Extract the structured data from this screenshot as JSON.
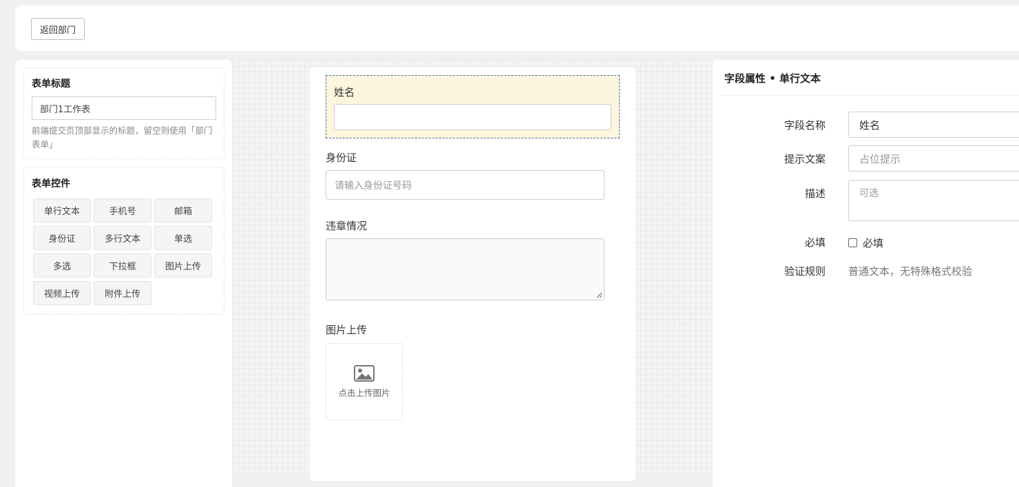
{
  "topbar": {
    "back_label": "返回部门"
  },
  "left": {
    "title_section": {
      "heading": "表单标题",
      "input_value": "部门1工作表",
      "hint": "前端提交页顶部显示的标题，留空则使用「部门表单」"
    },
    "controls_section": {
      "heading": "表单控件",
      "items": [
        "单行文本",
        "手机号",
        "邮箱",
        "身份证",
        "多行文本",
        "单选",
        "多选",
        "下拉框",
        "图片上传",
        "视频上传",
        "附件上传"
      ]
    }
  },
  "form": {
    "fields": [
      {
        "label": "姓名",
        "type": "text",
        "placeholder": ""
      },
      {
        "label": "身份证",
        "type": "text",
        "placeholder": "请输入身份证号码"
      },
      {
        "label": "违章情况",
        "type": "textarea"
      },
      {
        "label": "图片上传",
        "type": "image",
        "upload_text": "点击上传图片"
      }
    ]
  },
  "props": {
    "title": "字段属性 • 单行文本",
    "name_label": "字段名称",
    "name_value": "姓名",
    "placeholder_label": "提示文案",
    "placeholder_hint": "占位提示",
    "desc_label": "描述",
    "desc_hint": "可选",
    "required_label": "必填",
    "required_check_label": "必填",
    "required_checked": false,
    "rule_label": "验证规则",
    "rule_text": "普通文本，无特殊格式校验"
  },
  "colors": {
    "selected_bg": "#fdf6dc",
    "selected_border": "#3a6ea5"
  }
}
